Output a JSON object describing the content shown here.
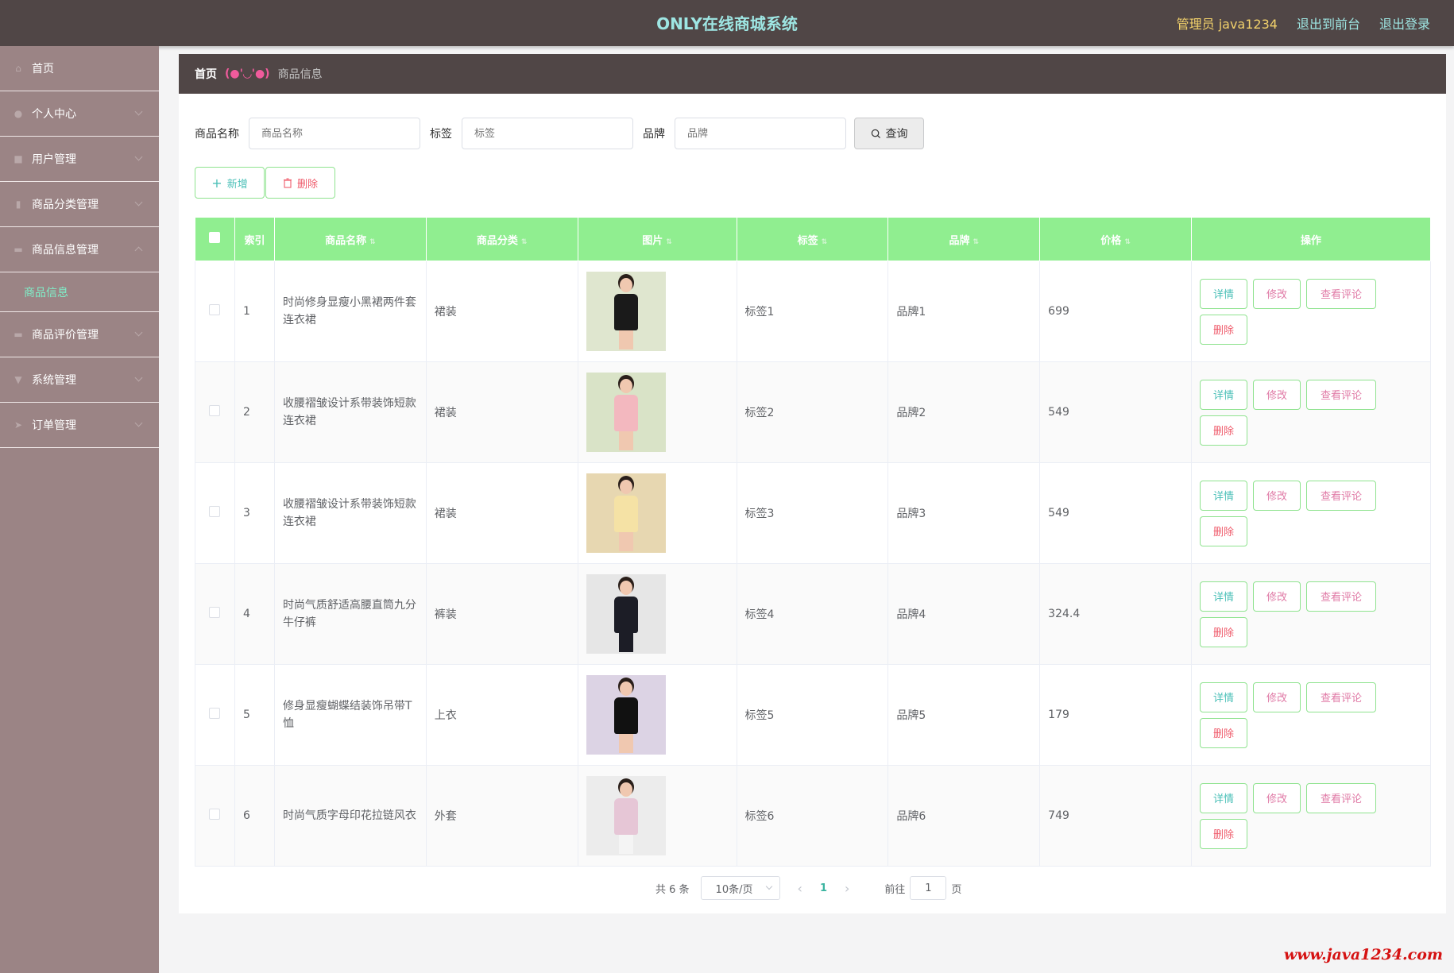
{
  "header": {
    "title": "ONLY在线商城系统",
    "admin": "管理员 java1234",
    "to_front": "退出到前台",
    "logout": "退出登录"
  },
  "sidebar": {
    "items": [
      {
        "label": "首页",
        "icon": "home-icon"
      },
      {
        "label": "个人中心",
        "icon": "user-icon"
      },
      {
        "label": "用户管理",
        "icon": "users-icon"
      },
      {
        "label": "商品分类管理",
        "icon": "category-icon"
      },
      {
        "label": "商品信息管理",
        "icon": "goods-icon"
      },
      {
        "label": "商品评价管理",
        "icon": "comment-icon"
      },
      {
        "label": "系统管理",
        "icon": "system-icon"
      },
      {
        "label": "订单管理",
        "icon": "order-icon"
      }
    ],
    "sub_item": "商品信息"
  },
  "breadcrumb": {
    "home": "首页",
    "separator": "(●'◡'●)",
    "current": "商品信息"
  },
  "search": {
    "name_label": "商品名称",
    "name_placeholder": "商品名称",
    "tag_label": "标签",
    "tag_placeholder": "标签",
    "brand_label": "品牌",
    "brand_placeholder": "品牌",
    "query_label": "查询"
  },
  "actions": {
    "add_label": "新增",
    "delete_label": "删除"
  },
  "table": {
    "headers": [
      "索引",
      "商品名称",
      "商品分类",
      "图片",
      "标签",
      "品牌",
      "价格",
      "操作"
    ],
    "rows": [
      {
        "index": "1",
        "name": "时尚修身显瘦小黑裙两件套连衣裙",
        "category": "裙装",
        "tag": "标签1",
        "brand": "品牌1",
        "price": "699"
      },
      {
        "index": "2",
        "name": "收腰褶皱设计系带装饰短款连衣裙",
        "category": "裙装",
        "tag": "标签2",
        "brand": "品牌2",
        "price": "549"
      },
      {
        "index": "3",
        "name": "收腰褶皱设计系带装饰短款连衣裙",
        "category": "裙装",
        "tag": "标签3",
        "brand": "品牌3",
        "price": "549"
      },
      {
        "index": "4",
        "name": "时尚气质舒适高腰直筒九分牛仔裤",
        "category": "裤装",
        "tag": "标签4",
        "brand": "品牌4",
        "price": "324.4"
      },
      {
        "index": "5",
        "name": "修身显瘦蝴蝶结装饰吊带T恤",
        "category": "上衣",
        "tag": "标签5",
        "brand": "品牌5",
        "price": "179"
      },
      {
        "index": "6",
        "name": "时尚气质字母印花拉链风衣",
        "category": "外套",
        "tag": "标签6",
        "brand": "品牌6",
        "price": "749"
      }
    ],
    "ops": {
      "detail": "详情",
      "edit": "修改",
      "review": "查看评论",
      "remove": "删除"
    }
  },
  "pagination": {
    "total": "共 6 条",
    "page_size": "10条/页",
    "current_page": "1",
    "goto_label": "前往",
    "goto_value": "1",
    "page_unit": "页"
  },
  "watermark": "www.java1234.com",
  "colors": {
    "header_bg": "#504646",
    "sidebar_bg": "#9b8485",
    "table_header_bg": "#90ee90",
    "accent_teal": "#9ee6e3",
    "accent_gold": "#f2d16b"
  }
}
